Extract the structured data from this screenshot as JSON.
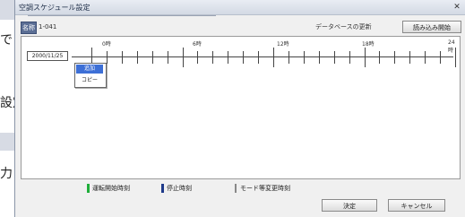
{
  "background_window": {
    "line1": "で",
    "line2": "設定",
    "line3": "力"
  },
  "dialog": {
    "title": "空調スケジュール設定",
    "close_glyph": "✕",
    "name_label": "名称",
    "name_value": "1-041",
    "db_label": "データベースの更新",
    "load_button": "読み込み開始"
  },
  "timeline": {
    "tick_labels": [
      "0時",
      "6時",
      "12時",
      "18時",
      "24時"
    ],
    "date": "2000/11/25",
    "context_menu": [
      "追加",
      "コピー"
    ]
  },
  "legend": {
    "items": [
      {
        "label": "運転開始時刻",
        "color": "#1fae3a"
      },
      {
        "label": "停止時刻",
        "color": "#1f3a8a"
      },
      {
        "label": "モード等変更時刻",
        "color": "#888888"
      }
    ]
  },
  "buttons": {
    "ok": "決定",
    "cancel": "キャンセル"
  }
}
